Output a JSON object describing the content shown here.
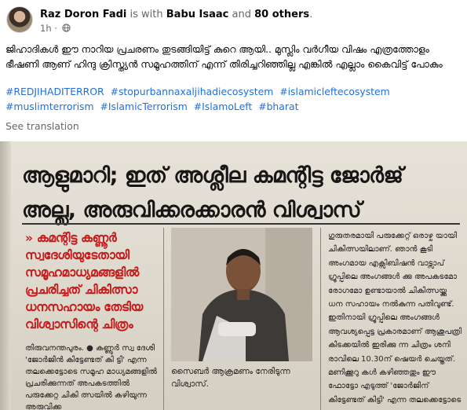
{
  "post": {
    "author": "Raz Doron Fadi",
    "is_with": "is with",
    "tagged": "Babu Isaac",
    "and_text": "and",
    "others": "80 others",
    "period": ".",
    "time": "1h",
    "dot": "·",
    "body": "ജിഹാദികൾ ഈ നാറിയ പ്രചരണം തുടങ്ങിയിട്ട് കുറെ ആയി.. മുസ്ലിം വർഗീയ വിഷം എത്രത്തോളം ഭീഷണി ആണ് ഹിന്ദു ക്രിസ്ത്യൻ സമൂഹത്തിന് എന്ന് തിരിച്ചറിഞ്ഞില്ല എങ്കിൽ എല്ലാം കൈവിട്ട് പോകും",
    "hashtags": [
      "#REDJIHADITERROR",
      "#stopurbannaxaljihadiecosystem",
      "#islamicleftecosystem",
      "#muslimterrorism",
      "#IslamicTerrorism",
      "#IslamoLeft",
      "#bharat"
    ],
    "see_translation": "See translation"
  },
  "clipping": {
    "headline_line1": "ആളുമാറി; ഇത് അശ്ലീല കമന്റിട്ട ജോർജ്",
    "headline_line2": "അല്ല, അരുവിക്കരക്കാരൻ വിശ്വാസ്",
    "red_box": "കമന്റിട്ട കണ്ണൂർ സ്വദേശിയുടേതായി സമൂഹമാധ്യമങ്ങളിൽ പ്രചരിച്ചത് ചികിത്സാ ധനസഹായം തേടിയ വിശ്വാസിന്റെ ചിത്രം",
    "red_arrow": "»",
    "left_col": "തിരുവനന്തപുരം. ● കണ്ണൂർ സ്വ ദേശി 'ജോർജിൻ കിട്ടേണ്ടത് കി ട്ടി' എന്ന തലക്കെട്ടോടെ സമൂഹ മാധ്യമങ്ങളിൽ പ്രചരിക്കുന്നത് അപകടത്തിൽ പരുക്കേറ്റ ചികി ത്സയിൽ കഴിയുന്ന അരുവിക്ക",
    "caption": "സൈബർ ആക്രമണം നേരിടുന്ന വിശ്വാസ്.",
    "right_col": "ഗുരുതരമായി പരുക്കേറ്റ് ഒരാഴ്ച യായി ചികിത്സയിലാണ്. ഞാൻ കൂടി അംഗമായ എക്സിബിഷൻ വാട്സാപ് ഗ്രൂപ്പിലെ അംഗങ്ങൾ ക്കു അപകടമോ രോഗമോ ഉണ്ടായാൽ ചികിത്സയ്ക്കു ധന സഹായം നൽകുന്ന പതിവുണ്ട്. ഇതിനായി ഗ്രൂപ്പിലെ അംഗങ്ങൾ ആവശ്യപ്പെട്ട പ്രകാരമാണ് ആശുപത്രി കിടക്കയിൽ ഇരിക്കു ന്ന ചിത്രം ശനി രാവിലെ 10.30ന് ഷെയർ ചെയ്തത്. മണിക്കൂറു കൾ കഴിഞ്ഞതും ഈ ഫോട്ടോ എടുത്ത് 'ജോർജിന് കിട്ടേണ്ടത് കിട്ടി' എന്ന തലക്കെട്ടോടെ"
  },
  "colors": {
    "link": "#216fdb",
    "muted": "#65676b",
    "text": "#050505",
    "headline_red": "#c61c1c"
  },
  "icons": [
    "avatar",
    "globe-icon",
    "person-photo"
  ]
}
